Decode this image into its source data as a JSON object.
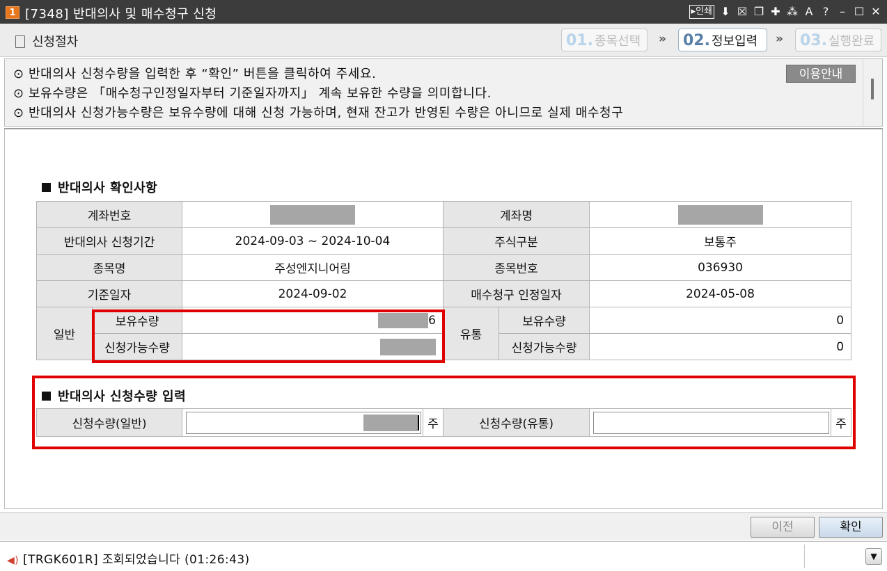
{
  "window": {
    "number": "1",
    "title": "[7348] 반대의사 및 매수청구 신청",
    "controls": [
      "▸인쇄",
      "⬇",
      "☒",
      "❐",
      "✚",
      "⁂",
      "A",
      "?",
      "–",
      "☐",
      "✕"
    ]
  },
  "steps": {
    "procedure_label": "신청절차",
    "items": [
      {
        "num": "01.",
        "label": "종목선택"
      },
      {
        "num": "02.",
        "label": "정보입력"
      },
      {
        "num": "03.",
        "label": "실행완료"
      }
    ],
    "arrow": "»"
  },
  "notice": {
    "lines": [
      "⊙ 반대의사 신청수량을 입력한 후 “확인” 버튼을 클릭하여 주세요.",
      "⊙ 보유수량은 「매수청구인정일자부터 기준일자까지」 계속 보유한 수량을 의미합니다.",
      "⊙ 반대의사 신청가능수량은 보유수량에 대해 신청 가능하며, 현재 잔고가 반영된 수량은 아니므로 실제 매수청구"
    ],
    "guide_button": "이용안내"
  },
  "confirm_section": {
    "title": "반대의사 확인사항",
    "account_no_label": "계좌번호",
    "account_name_label": "계좌명",
    "period_label": "반대의사 신청기간",
    "period_value": "2024-09-03 ~ 2024-10-04",
    "stock_type_label": "주식구분",
    "stock_type_value": "보통주",
    "item_name_label": "종목명",
    "item_name_value": "주성엔지니어링",
    "item_code_label": "종목번호",
    "item_code_value": "036930",
    "base_date_label": "기준일자",
    "base_date_value": "2024-09-02",
    "claim_date_label": "매수청구 인정일자",
    "claim_date_value": "2024-05-08",
    "general_label": "일반",
    "circulation_label": "유통",
    "holding_label": "보유수량",
    "available_label": "신청가능수량",
    "general_holding_tail": "6",
    "circ_holding_value": "0",
    "circ_available_value": "0"
  },
  "input_section": {
    "title": "반대의사 신청수량 입력",
    "general_qty_label": "신청수량(일반)",
    "circ_qty_label": "신청수량(유통)",
    "unit": "주",
    "circ_qty_value": ""
  },
  "buttons": {
    "prev": "이전",
    "confirm": "확인"
  },
  "status": {
    "message": "[TRGK601R] 조회되었습니다 (01:26:43)"
  }
}
